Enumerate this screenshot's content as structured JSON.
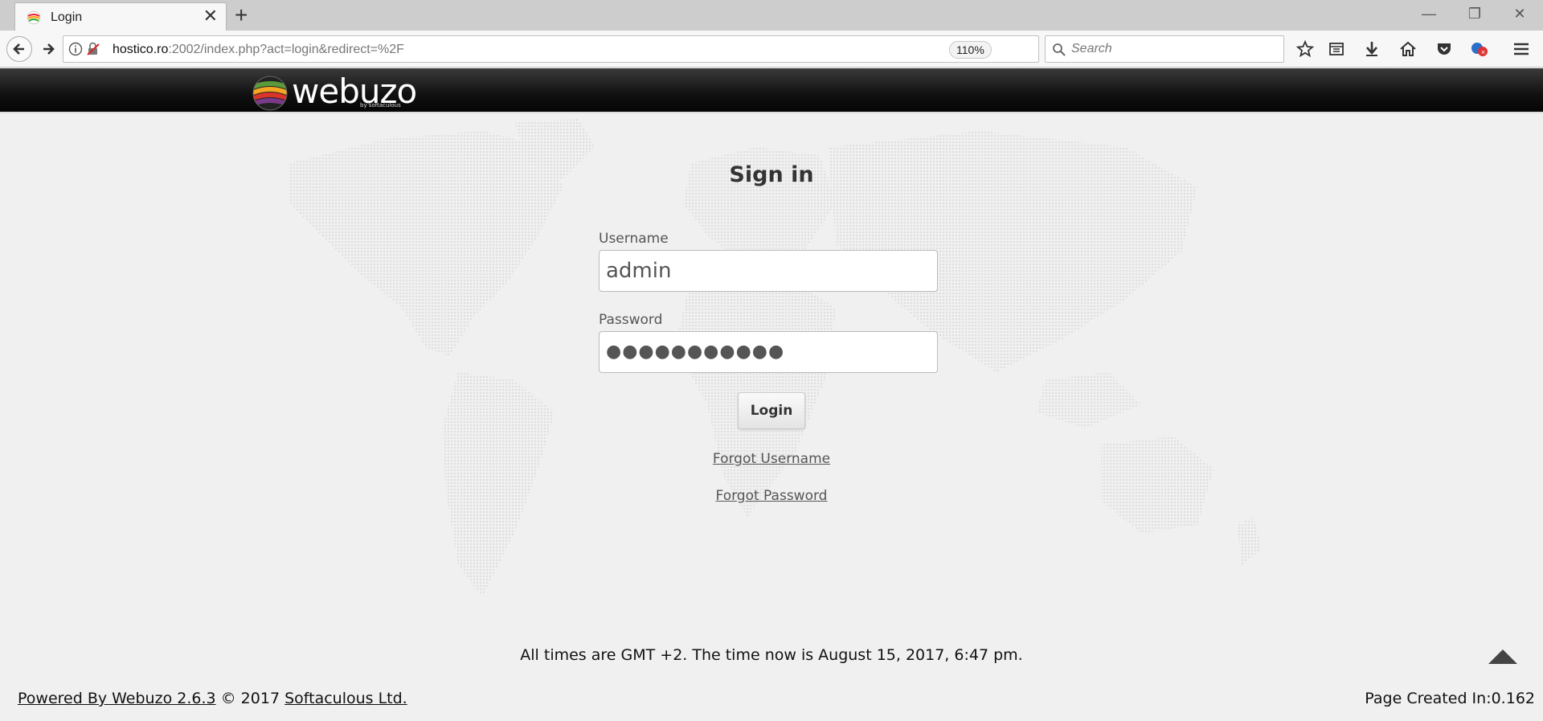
{
  "browser": {
    "tab_title": "Login",
    "url_host": "hostico.ro",
    "url_rest": ":2002/index.php?act=login&redirect=%2F",
    "zoom": "110%",
    "search_placeholder": "Search",
    "icons": [
      "back-arrow-icon",
      "forward-arrow-icon",
      "info-icon",
      "insecure-lock-icon",
      "reload-icon",
      "search-icon",
      "star-icon",
      "reading-list-icon",
      "download-icon",
      "home-icon",
      "pocket-icon",
      "extension-icon",
      "hamburger-menu-icon"
    ]
  },
  "header": {
    "logo_text": "webuzo",
    "logo_sub": "by softaculous"
  },
  "form": {
    "title": "Sign in",
    "username_label": "Username",
    "username_value": "admin",
    "password_label": "Password",
    "password_value": "●●●●●●●●●●●",
    "login_label": "Login",
    "forgot_username": "Forgot Username",
    "forgot_password": "Forgot Password"
  },
  "footer": {
    "time_note": "All times are GMT +2. The time now is August 15, 2017, 6:47 pm.",
    "powered_by": "Powered By Webuzo 2.6.3",
    "copyright": " © 2017 ",
    "company": "Softaculous Ltd.",
    "page_created": "Page Created In:0.162"
  }
}
